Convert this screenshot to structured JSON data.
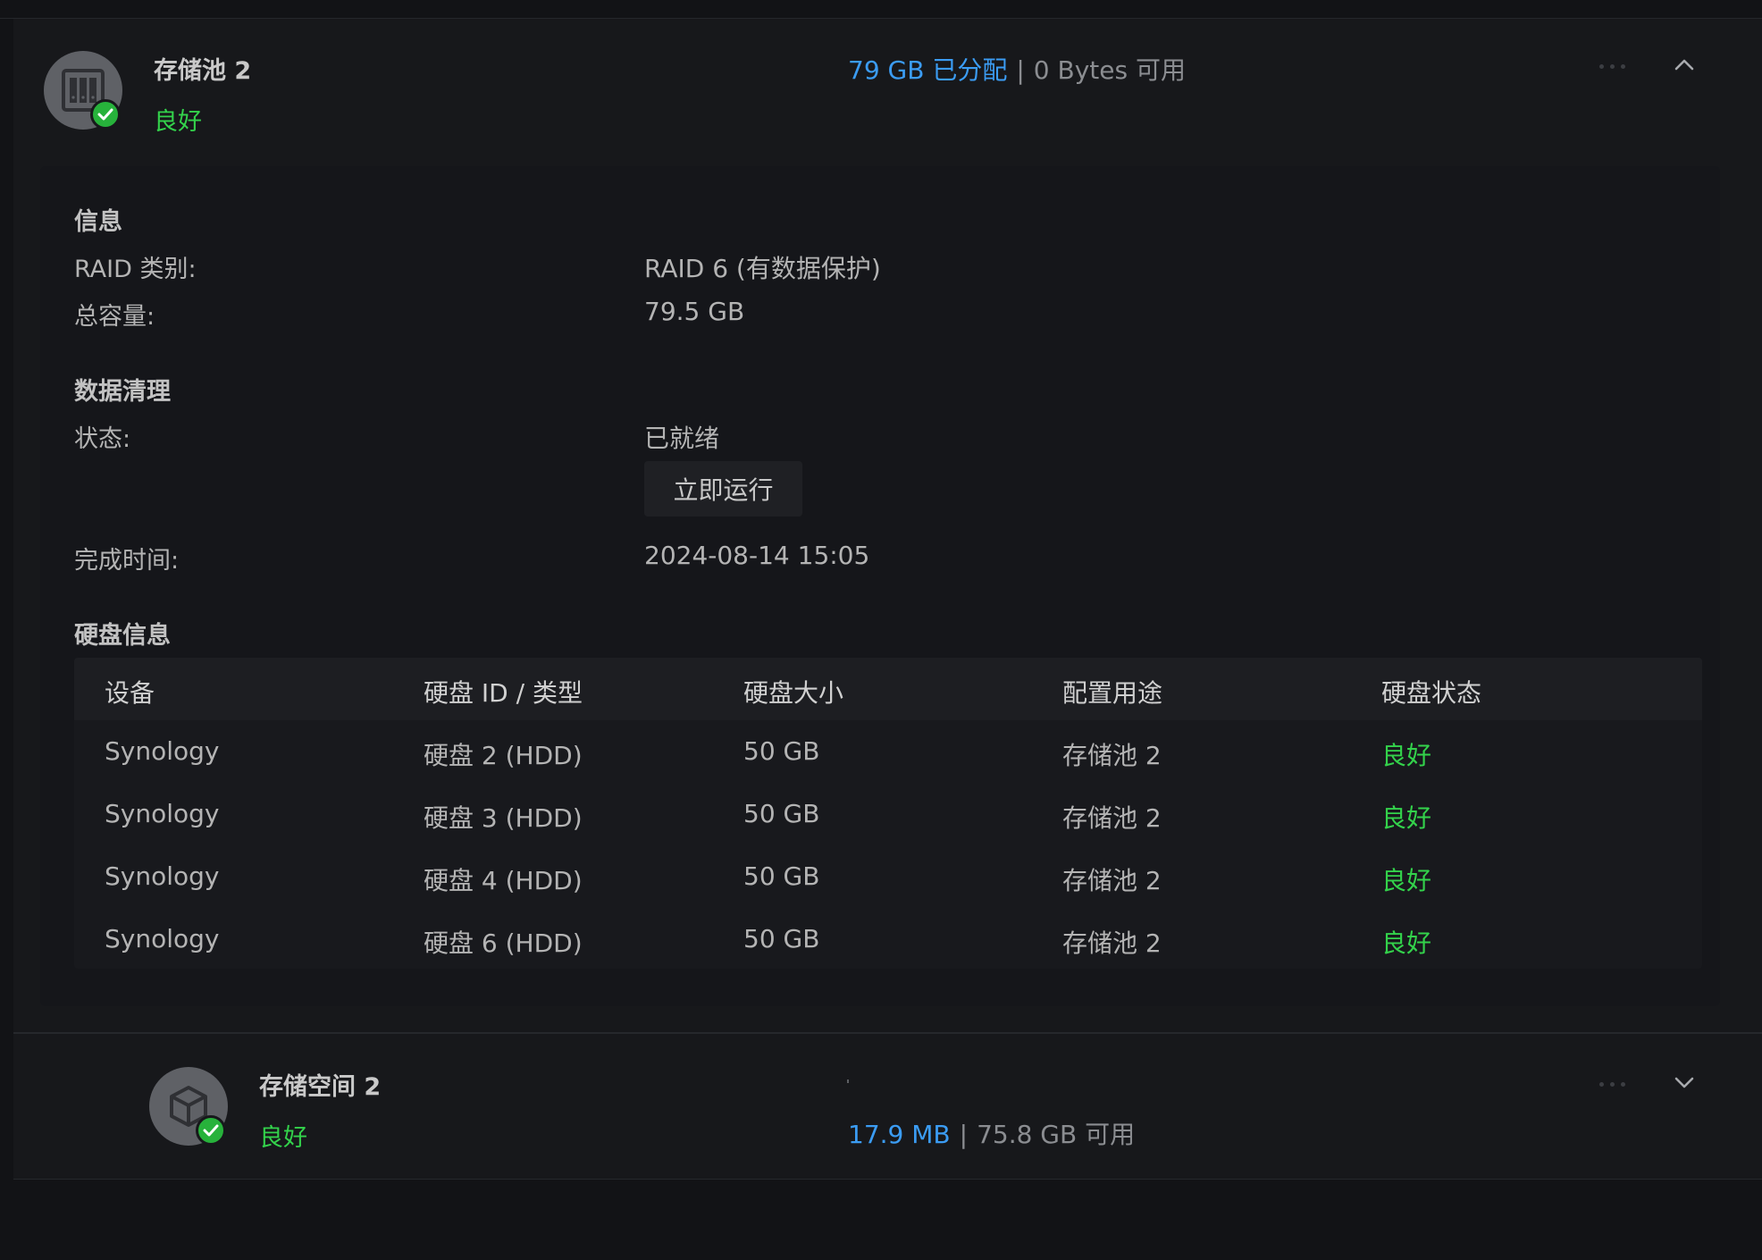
{
  "pool": {
    "title": "存储池 2",
    "status": "良好",
    "usage_allocated": "79 GB 已分配",
    "usage_separator": "|",
    "usage_available": "0 Bytes 可用",
    "icon": "storage-pool-icon"
  },
  "info": {
    "section_title": "信息",
    "raid_label": "RAID 类别:",
    "raid_value": "RAID 6 (有数据保护)",
    "capacity_label": "总容量:",
    "capacity_value": "79.5 GB"
  },
  "scrub": {
    "section_title": "数据清理",
    "status_label": "状态:",
    "status_value": "已就绪",
    "run_button": "立即运行",
    "finish_label": "完成时间:",
    "finish_value": "2024-08-14 15:05"
  },
  "disks": {
    "section_title": "硬盘信息",
    "columns": [
      "设备",
      "硬盘 ID / 类型",
      "硬盘大小",
      "配置用途",
      "硬盘状态"
    ],
    "rows": [
      [
        "Synology",
        "硬盘 2 (HDD)",
        "50 GB",
        "存储池 2",
        "良好"
      ],
      [
        "Synology",
        "硬盘 3 (HDD)",
        "50 GB",
        "存储池 2",
        "良好"
      ],
      [
        "Synology",
        "硬盘 4 (HDD)",
        "50 GB",
        "存储池 2",
        "良好"
      ],
      [
        "Synology",
        "硬盘 6 (HDD)",
        "50 GB",
        "存储池 2",
        "良好"
      ]
    ]
  },
  "volume": {
    "title": "存储空间 2",
    "status": "良好",
    "usage_used": "17.9 MB",
    "usage_separator": "|",
    "usage_available": "75.8 GB 可用",
    "icon": "volume-cube-icon"
  },
  "colors": {
    "good": "#33d24b",
    "accent": "#3b9cf3",
    "background": "#17181b"
  }
}
